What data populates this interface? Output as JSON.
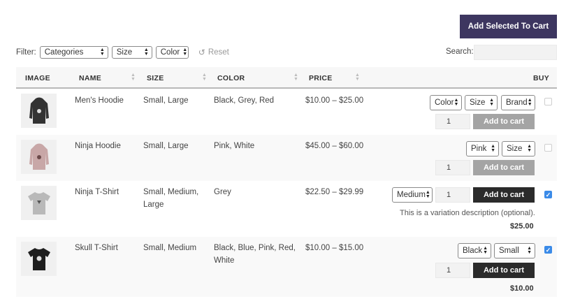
{
  "toolbar": {
    "add_selected_label": "Add Selected To Cart"
  },
  "filter": {
    "label": "Filter:",
    "categories": "Categories",
    "size": "Size",
    "color": "Color",
    "reset_label": "Reset"
  },
  "search": {
    "label": "Search:",
    "value": ""
  },
  "table": {
    "headers": {
      "image": "IMAGE",
      "name": "NAME",
      "size": "SIZE",
      "color": "COLOR",
      "price": "PRICE",
      "buy": "BUY"
    },
    "rows": [
      {
        "name": "Men's Hoodie",
        "size_line1": "Small, Large",
        "size_line2": "",
        "color_line1": "Black, Grey, Red",
        "color_line2": "",
        "price": "$10.00 – $25.00",
        "variations": [
          "Color",
          "Size",
          "Brand"
        ],
        "qty": "1",
        "add_label": "Add to cart",
        "add_enabled": false,
        "checked": false,
        "variation_description": "",
        "variation_price": "",
        "product_color": "#333333"
      },
      {
        "name": "Ninja Hoodie",
        "size_line1": "Small, Large",
        "size_line2": "",
        "color_line1": "Pink, White",
        "color_line2": "",
        "price": "$45.00 – $60.00",
        "variations": [
          "Pink",
          "Size"
        ],
        "qty": "1",
        "add_label": "Add to cart",
        "add_enabled": false,
        "checked": false,
        "variation_description": "",
        "variation_price": "",
        "product_color": "#c8a7a7"
      },
      {
        "name": "Ninja T-Shirt",
        "size_line1": "Small, Medium,",
        "size_line2": "Large",
        "color_line1": "Grey",
        "color_line2": "",
        "price": "$22.50 – $29.99",
        "variations": [
          "Medium"
        ],
        "qty": "1",
        "add_label": "Add to cart",
        "add_enabled": true,
        "checked": true,
        "variation_description": "This is a variation description (optional).",
        "variation_price": "$25.00",
        "product_color": "#b9b9b9"
      },
      {
        "name": "Skull T-Shirt",
        "size_line1": "Small, Medium",
        "size_line2": "",
        "color_line1": "Black, Blue, Pink, Red,",
        "color_line2": "White",
        "price": "$10.00 – $15.00",
        "variations": [
          "Black",
          "Small"
        ],
        "qty": "1",
        "add_label": "Add to cart",
        "add_enabled": true,
        "checked": true,
        "variation_description": "",
        "variation_price": "$10.00",
        "product_color": "#1e1e1e"
      }
    ]
  }
}
